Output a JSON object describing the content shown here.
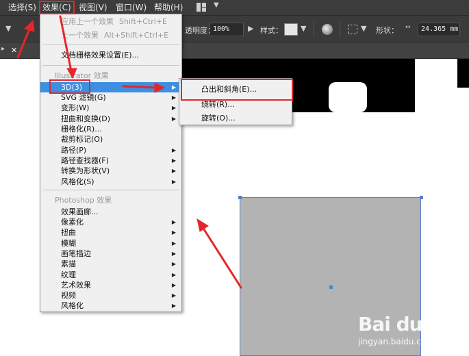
{
  "menubar": {
    "items": [
      {
        "label": "选择(S)"
      },
      {
        "label": "效果(C)"
      },
      {
        "label": "视图(V)"
      },
      {
        "label": "窗口(W)"
      },
      {
        "label": "帮助(H)"
      }
    ]
  },
  "controlbar": {
    "opacity_label": "透明度：",
    "opacity_value": "100%",
    "style_label": "样式：",
    "shape_label": "形状：",
    "shape_value": "24.365 mm"
  },
  "effect_menu": {
    "apply_last": "应用上一个效果",
    "apply_last_shortcut": "Shift+Ctrl+E",
    "last_effect": "上一个效果",
    "last_effect_shortcut": "Alt+Shift+Ctrl+E",
    "raster_settings": "文档栅格效果设置(E)...",
    "illustrator_section": "Illustrator 效果",
    "illustrator_items": [
      {
        "label": "3D(3)",
        "submenu": true
      },
      {
        "label": "SVG 滤镜(G)",
        "submenu": true
      },
      {
        "label": "变形(W)",
        "submenu": true
      },
      {
        "label": "扭曲和变换(D)",
        "submenu": true
      },
      {
        "label": "栅格化(R)...",
        "submenu": false
      },
      {
        "label": "裁剪标记(O)",
        "submenu": false
      },
      {
        "label": "路径(P)",
        "submenu": true
      },
      {
        "label": "路径查找器(F)",
        "submenu": true
      },
      {
        "label": "转换为形状(V)",
        "submenu": true
      },
      {
        "label": "风格化(S)",
        "submenu": true
      }
    ],
    "photoshop_section": "Photoshop 效果",
    "photoshop_items": [
      {
        "label": "效果画廊...",
        "submenu": false
      },
      {
        "label": "像素化",
        "submenu": true
      },
      {
        "label": "扭曲",
        "submenu": true
      },
      {
        "label": "模糊",
        "submenu": true
      },
      {
        "label": "画笔描边",
        "submenu": true
      },
      {
        "label": "素描",
        "submenu": true
      },
      {
        "label": "纹理",
        "submenu": true
      },
      {
        "label": "艺术效果",
        "submenu": true
      },
      {
        "label": "视频",
        "submenu": true
      },
      {
        "label": "风格化",
        "submenu": true
      }
    ]
  },
  "submenu_3d": {
    "items": [
      {
        "label": "凸出和斜角(E)..."
      },
      {
        "label": "绕转(R)..."
      },
      {
        "label": "旋转(O)..."
      }
    ]
  },
  "watermark": {
    "logo": "Bai du 经验",
    "url": "jingyan.baidu.com"
  },
  "colors": {
    "menubar_bg": "#3c3c3c",
    "highlight": "#3d8fe2",
    "annotation_red": "#e3272b",
    "selection_blue": "#4f7fd8",
    "shape_fill": "#b3b3b3"
  }
}
